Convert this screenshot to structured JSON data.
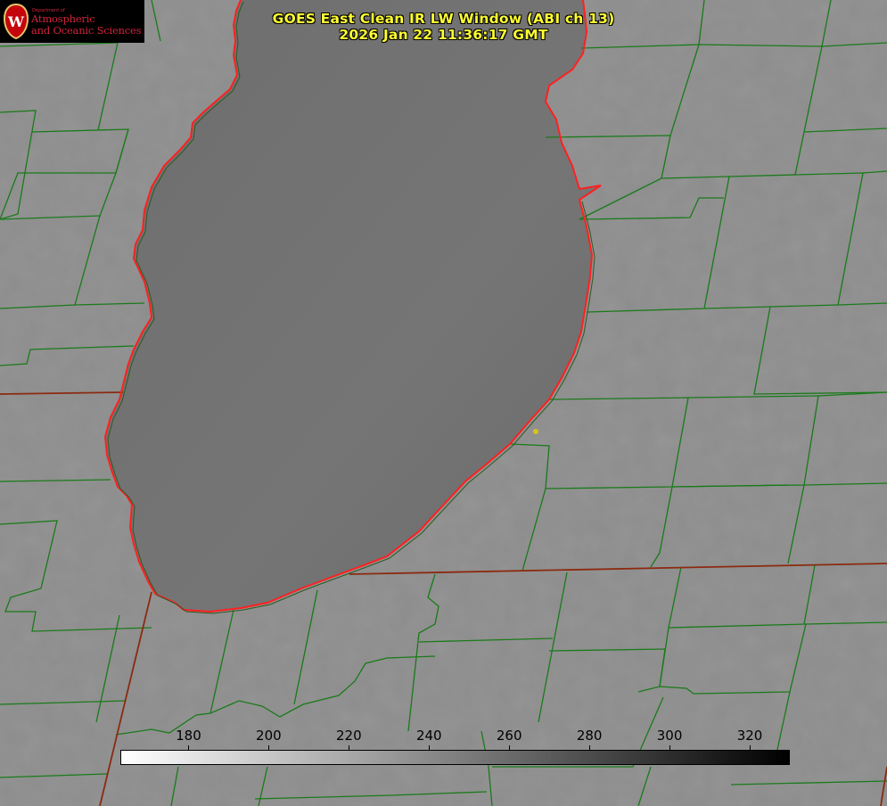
{
  "title": {
    "line1": "GOES East Clean IR LW Window (ABI ch 13)",
    "line2": "2026 Jan 22 11:36:17 GMT"
  },
  "logo": {
    "department_label": "Department of",
    "name_line1": "Atmospheric",
    "name_line2": "and Oceanic Sciences",
    "seal_letter": "W"
  },
  "colorbar": {
    "ticks": [
      "180",
      "200",
      "220",
      "240",
      "260",
      "280",
      "300",
      "320"
    ],
    "tick_values": [
      180,
      200,
      220,
      240,
      260,
      280,
      300,
      320
    ],
    "range": [
      163,
      330
    ],
    "start_color": "#ffffff",
    "end_color": "#000000"
  },
  "colors": {
    "land": "#8e8e8e",
    "lake": "#707070",
    "county_lines": "#1a7a1a",
    "lake_outline": "#ff2020",
    "state_lines": "#8b2a10",
    "title_text": "#ffff33",
    "marker": "#d4c51a"
  }
}
